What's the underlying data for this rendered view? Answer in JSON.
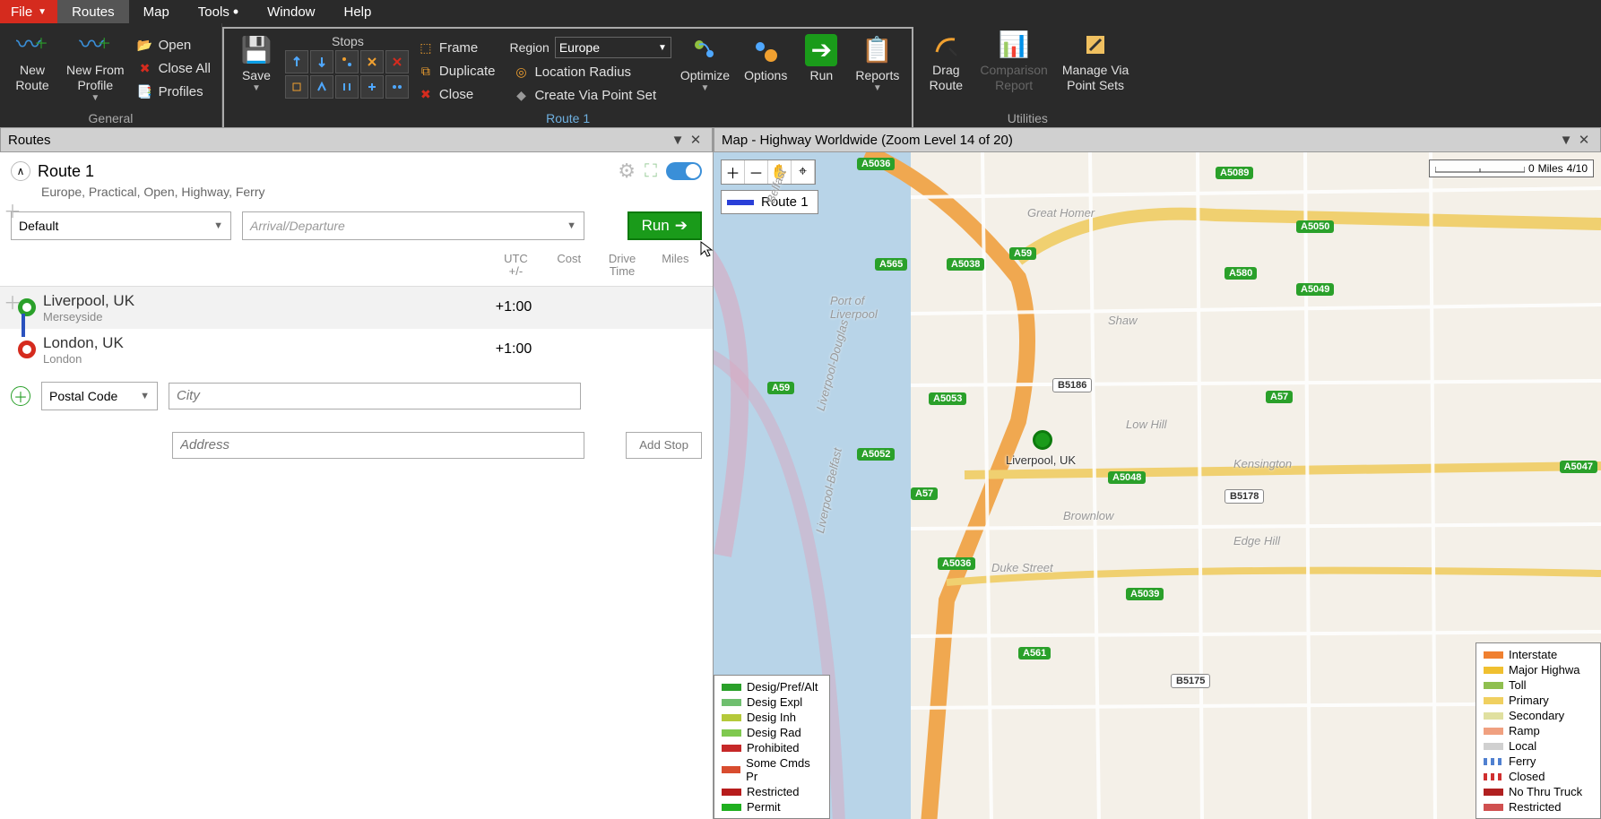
{
  "menu": {
    "file": "File",
    "routes": "Routes",
    "map": "Map",
    "tools": "Tools",
    "window": "Window",
    "help": "Help"
  },
  "ribbon": {
    "general": {
      "label": "General",
      "new_route": "New\nRoute",
      "new_from_profile": "New From\nProfile",
      "open": "Open",
      "close_all": "Close All",
      "profiles": "Profiles"
    },
    "route1": {
      "label": "Route 1",
      "save": "Save",
      "stops_label": "Stops",
      "frame": "Frame",
      "duplicate": "Duplicate",
      "close": "Close",
      "region_label": "Region",
      "region_value": "Europe",
      "location_radius": "Location Radius",
      "create_via": "Create Via Point Set",
      "optimize": "Optimize",
      "options": "Options",
      "run": "Run",
      "reports": "Reports"
    },
    "utilities": {
      "label": "Utilities",
      "drag_route": "Drag\nRoute",
      "comparison": "Comparison\nReport",
      "manage_via": "Manage Via\nPoint Sets"
    }
  },
  "routes_panel": {
    "title": "Routes",
    "route_name": "Route 1",
    "route_sub": "Europe, Practical, Open, Highway, Ferry",
    "default_sel": "Default",
    "arrival_placeholder": "Arrival/Departure",
    "run_btn": "Run",
    "cols": {
      "utc": "UTC\n+/-",
      "cost": "Cost",
      "drive": "Drive\nTime",
      "miles": "Miles"
    },
    "stops": [
      {
        "name": "Liverpool, UK",
        "sub": "Merseyside",
        "utc": "+1:00"
      },
      {
        "name": "London, UK",
        "sub": "London",
        "utc": "+1:00"
      }
    ],
    "postal_sel": "Postal Code",
    "city_ph": "City",
    "address_ph": "Address",
    "add_stop": "Add Stop"
  },
  "map_panel": {
    "title": "Map - Highway Worldwide (Zoom Level 14 of 20)",
    "legend_route": "Route 1",
    "scale": {
      "unit": "Miles",
      "val": "4/10"
    },
    "marker_city": "Liverpool, UK",
    "roads": {
      "a5036a": "A5036",
      "a5089": "A5089",
      "a5050": "A5050",
      "a565": "A565",
      "a5038": "A5038",
      "a59a": "A59",
      "a580": "A580",
      "a5049": "A5049",
      "a59b": "A59",
      "b5186": "B5186",
      "a5053": "A5053",
      "a57a": "A57",
      "a5052": "A5052",
      "a57b": "A57",
      "a5047": "A5047",
      "b5178": "B5178",
      "a5048": "A5048",
      "a5036b": "A5036",
      "a5039": "A5039",
      "a561": "A561",
      "b5175": "B5175"
    },
    "areas": {
      "port": "Port of\nLiverpool",
      "greathomer": "Great Homer",
      "shaw": "Shaw",
      "lowhill": "Low Hill",
      "kensington": "Kensington",
      "brownlow": "Brownlow",
      "edgehill": "Edge Hill",
      "duke": "Duke Street",
      "belfast": "Belfast",
      "douglas": "Liverpool-Douglas",
      "livbelfast": "Liverpool-Belfast"
    },
    "legend_left": [
      {
        "c": "#2aa02a",
        "t": "Desig/Pref/Alt"
      },
      {
        "c": "#6fbf6f",
        "t": "Desig Expl"
      },
      {
        "c": "#b5c93a",
        "t": "Desig Inh"
      },
      {
        "c": "#7fc94f",
        "t": "Desig Rad"
      },
      {
        "c": "#c62828",
        "t": "Prohibited"
      },
      {
        "c": "#d84c2f",
        "t": "Some Cmds Pr"
      },
      {
        "c": "#b71c1c",
        "t": "Restricted"
      },
      {
        "c": "#1faf1f",
        "t": "Permit"
      }
    ],
    "legend_right": [
      {
        "c": "#f08030",
        "t": "Interstate"
      },
      {
        "c": "#f0c030",
        "t": "Major Highwa"
      },
      {
        "c": "#8fbf4f",
        "t": "Toll"
      },
      {
        "c": "#f0d060",
        "t": "Primary"
      },
      {
        "c": "#e0e0a0",
        "t": "Secondary"
      },
      {
        "c": "#f0a080",
        "t": "Ramp"
      },
      {
        "c": "#d0d0d0",
        "t": "Local"
      },
      {
        "c": "#5080d0",
        "t": "Ferry",
        "dash": true
      },
      {
        "c": "#d03030",
        "t": "Closed",
        "dash": true
      },
      {
        "c": "#b02020",
        "t": "No Thru Truck"
      },
      {
        "c": "#d05050",
        "t": "Restricted"
      }
    ]
  }
}
